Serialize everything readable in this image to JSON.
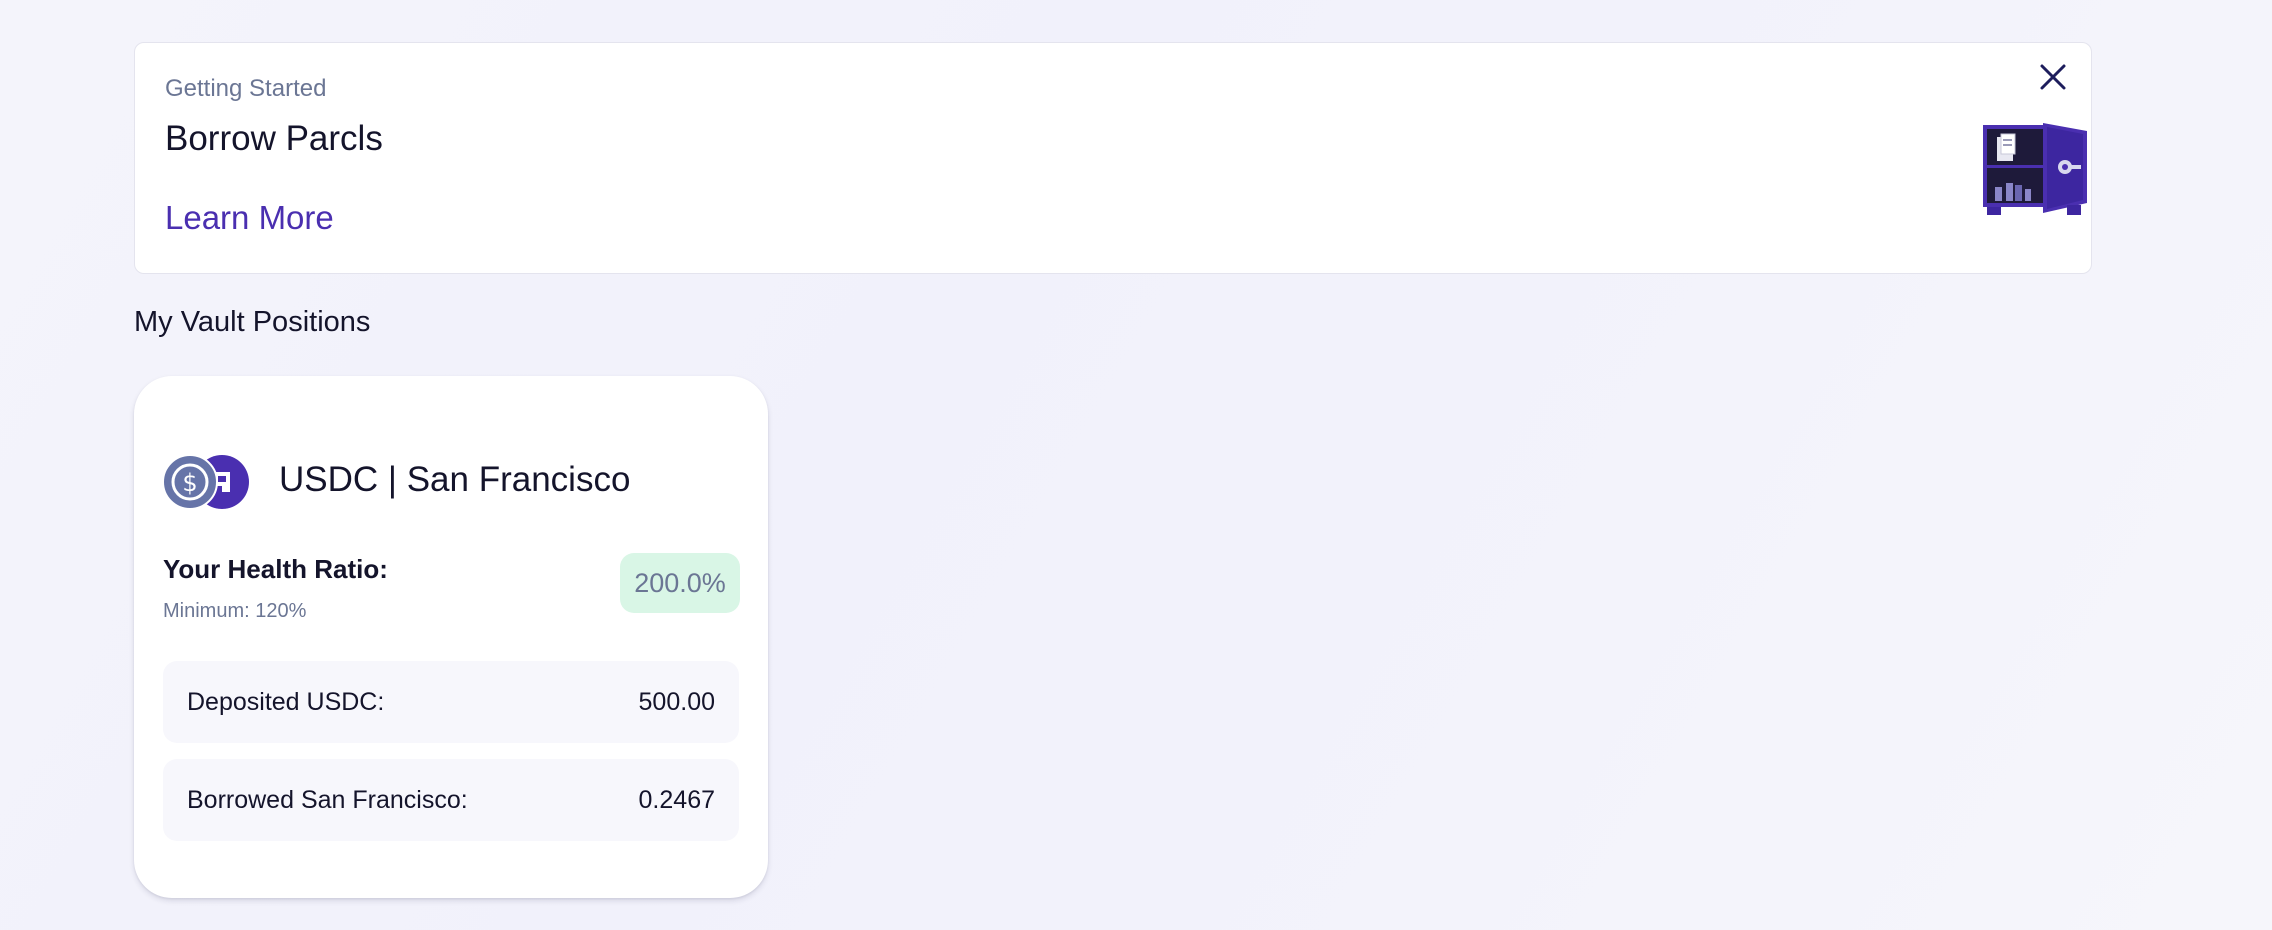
{
  "banner": {
    "kicker": "Getting Started",
    "title": "Borrow Parcls",
    "link_label": "Learn More",
    "illustration": "vault-safe-illustration",
    "close_icon": "close-icon"
  },
  "section": {
    "title": "My Vault Positions"
  },
  "vault": {
    "pair_name": "USDC | San Francisco",
    "icons": [
      "usdc-icon",
      "parcl-icon"
    ],
    "health_label": "Your Health Ratio:",
    "health_minimum": "Minimum: 120%",
    "health_value": "200.0%",
    "health_value_fraction": 2.0,
    "rows": [
      {
        "label": "Deposited USDC:",
        "value": "500.00"
      },
      {
        "label": "Borrowed San Francisco:",
        "value": "0.2467"
      }
    ]
  },
  "colors": {
    "accent": "#4a2fb0",
    "usdc": "#6674a8",
    "parcl": "#4a2fb0",
    "health_bg": "#d9f6e6",
    "muted_text": "#6b7694",
    "page_bg": "#f3f3fb"
  }
}
